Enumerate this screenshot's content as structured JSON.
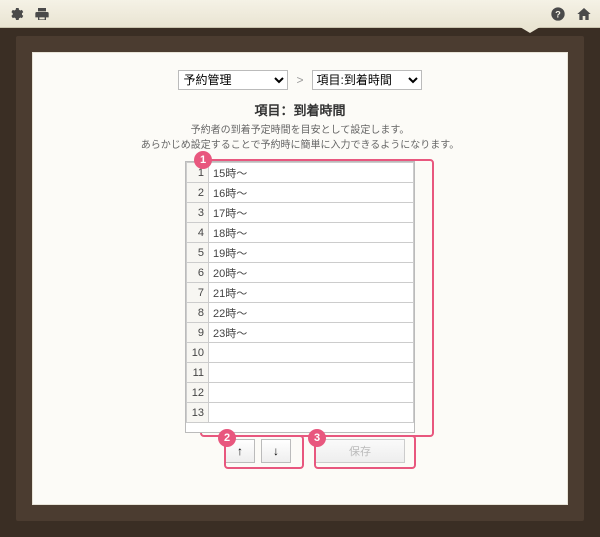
{
  "topbar": {
    "icons": {
      "settings": "gear-icon",
      "print": "print-icon",
      "help": "help-icon",
      "home": "home-icon"
    }
  },
  "breadcrumb": {
    "select1_value": "予約管理",
    "separator": ">",
    "select2_value": "項目:到着時間"
  },
  "title": "項目：到着時間",
  "description_line1": "予約者の到着予定時間を目安として設定します。",
  "description_line2": "あらかじめ設定することで予約時に簡単に入力できるようになります。",
  "rows": [
    {
      "n": 1,
      "v": "15時～"
    },
    {
      "n": 2,
      "v": "16時～"
    },
    {
      "n": 3,
      "v": "17時～"
    },
    {
      "n": 4,
      "v": "18時～"
    },
    {
      "n": 5,
      "v": "19時～"
    },
    {
      "n": 6,
      "v": "20時～"
    },
    {
      "n": 7,
      "v": "21時～"
    },
    {
      "n": 8,
      "v": "22時～"
    },
    {
      "n": 9,
      "v": "23時～"
    },
    {
      "n": 10,
      "v": ""
    },
    {
      "n": 11,
      "v": ""
    },
    {
      "n": 12,
      "v": ""
    },
    {
      "n": 13,
      "v": ""
    }
  ],
  "buttons": {
    "up": "↑",
    "down": "↓",
    "save": "保存"
  },
  "callouts": {
    "one": "1",
    "two": "2",
    "three": "3"
  },
  "colors": {
    "accent": "#e8577e"
  }
}
